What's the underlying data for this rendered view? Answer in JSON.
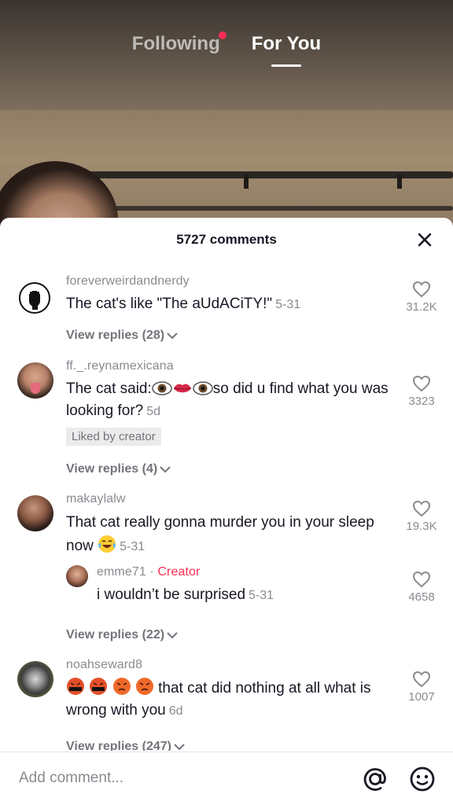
{
  "tabs": {
    "following": "Following",
    "for_you": "For You",
    "active": "For You",
    "notification_dot_color": "#fe2c55"
  },
  "comments_header": {
    "count_label": "5727 comments"
  },
  "comments": [
    {
      "username": "foreverweirdandnerdy",
      "text": "The cat's like \"The aUdACiTY!\"",
      "date": "5-31",
      "likes": "31.2K",
      "view_replies": "View replies (28)",
      "avatar_icon": "raised-fist-icon"
    },
    {
      "username": "ff._.reynamexicana",
      "text_before_emoji": "The cat said:",
      "emoji": [
        "eye-icon",
        "lips-icon",
        "eye-icon"
      ],
      "text_after_emoji": "so did u find what you was looking for?",
      "date": "5d",
      "liked_by_creator": "Liked by creator",
      "likes": "3323",
      "view_replies": "View replies (4)"
    },
    {
      "username": "makaylalw",
      "text": "That cat really gonna murder you in your sleep now",
      "emoji": [
        "tears-of-joy-icon"
      ],
      "date": "5-31",
      "likes": "19.3K",
      "reply": {
        "username": "emme71",
        "separator": " · ",
        "creator_label": "Creator",
        "text": "i wouldn’t be surprised",
        "date": "5-31",
        "likes": "4658"
      },
      "view_replies": "View replies (22)"
    },
    {
      "username": "noahseward8",
      "emoji": [
        "cursing-face-icon",
        "cursing-face-icon",
        "angry-face-icon",
        "angry-face-icon"
      ],
      "text": "that cat did nothing at all what is wrong with you",
      "date": "6d",
      "likes": "1007",
      "view_replies": "View replies (247)"
    }
  ],
  "input": {
    "placeholder": "Add comment..."
  },
  "colors": {
    "accent": "#fe2c55",
    "text_primary": "#161823",
    "text_secondary": "#8a8b91"
  }
}
